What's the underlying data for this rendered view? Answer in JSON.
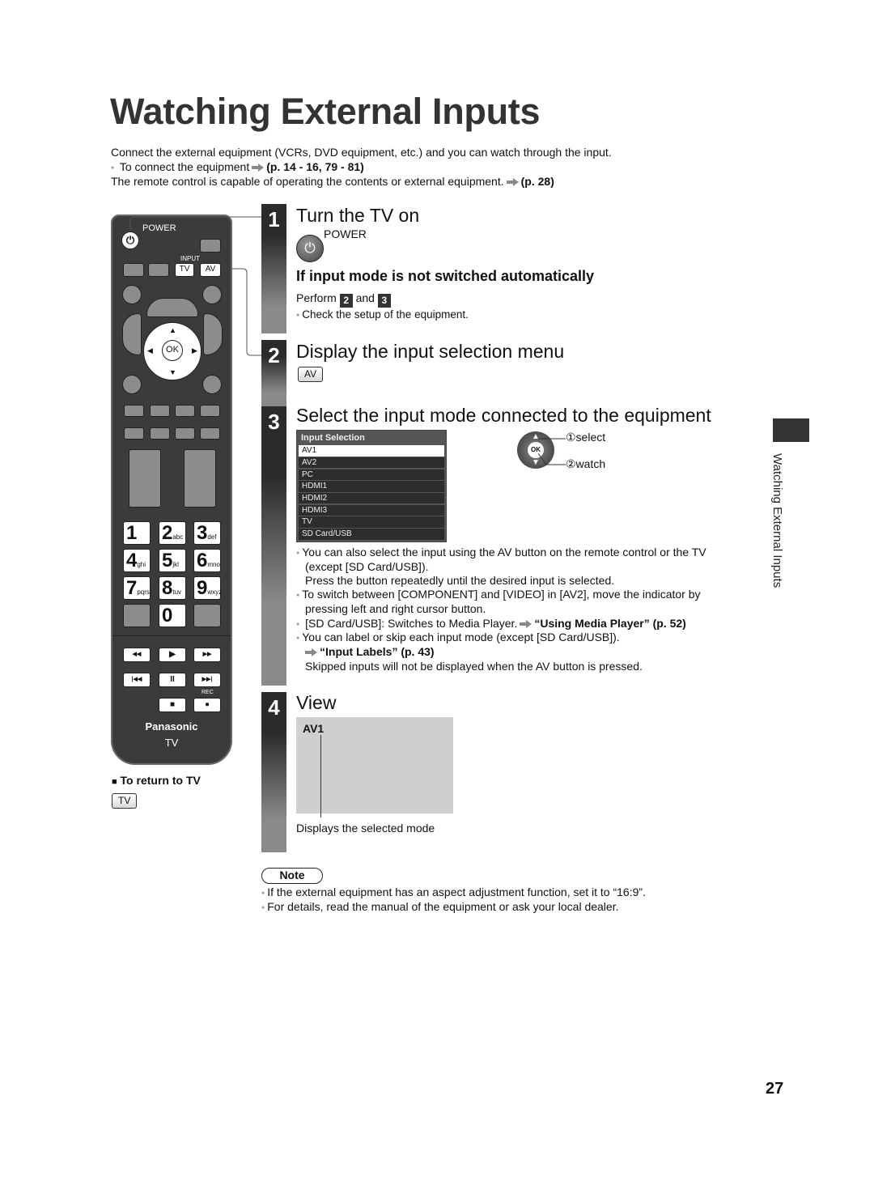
{
  "page": {
    "title": "Watching External Inputs",
    "intro_line1": "Connect the external equipment (VCRs, DVD equipment, etc.) and you can watch through the input.",
    "intro_bullet": "To connect the equipment",
    "intro_bullet_ref": "(p. 14 - 16, 79 - 81)",
    "intro_line3": "The remote control is capable of operating the contents or external equipment.",
    "intro_line3_ref": "(p. 28)",
    "page_number": "27",
    "side_label": "Watching External Inputs"
  },
  "remote": {
    "power_label": "POWER",
    "input_label": "INPUT",
    "tv_key": "TV",
    "av_key": "AV",
    "ok_label": "OK",
    "numpad": [
      {
        "digit": "1",
        "letters": ""
      },
      {
        "digit": "2",
        "letters": "abc"
      },
      {
        "digit": "3",
        "letters": "def"
      },
      {
        "digit": "4",
        "letters": "ghi"
      },
      {
        "digit": "5",
        "letters": "jkl"
      },
      {
        "digit": "6",
        "letters": "mno"
      },
      {
        "digit": "7",
        "letters": "pqrs"
      },
      {
        "digit": "8",
        "letters": "tuv"
      },
      {
        "digit": "9",
        "letters": "wxyz"
      },
      {
        "digit": "0",
        "letters": ""
      }
    ],
    "media": {
      "rewind": "◀◀",
      "play": "▶",
      "ffwd": "▶▶",
      "skip_back": "|◀◀",
      "pause": "II",
      "skip_fwd": "▶▶|",
      "stop": "■",
      "rec": "●",
      "rec_label": "REC"
    },
    "brand": "Panasonic",
    "model": "TV",
    "return_heading": "To return to TV",
    "return_key": "TV"
  },
  "steps": [
    {
      "number": "1",
      "heading": "Turn the TV on",
      "power_label": "POWER",
      "subheading": "If input mode is not switched automatically",
      "perform_prefix": "Perform",
      "perform_step_a": "2",
      "perform_and": "and",
      "perform_step_b": "3",
      "bullet": "Check the setup of the equipment."
    },
    {
      "number": "2",
      "heading": "Display the input selection menu",
      "key": "AV"
    },
    {
      "number": "3",
      "heading": "Select the input mode connected to the equipment",
      "menu": {
        "title": "Input Selection",
        "selected": "AV1",
        "items": [
          "AV1",
          "AV2",
          "PC",
          "HDMI1",
          "HDMI2",
          "HDMI3",
          "TV",
          "SD Card/USB"
        ]
      },
      "ok_label": "OK",
      "callout_select": "①select",
      "callout_watch": "②watch",
      "bullets": [
        {
          "text": "You can also select the input using the AV button on the remote control or the TV",
          "cont": [
            "(except [SD Card/USB]).",
            "Press the button repeatedly until the desired input is selected."
          ]
        },
        {
          "text": "To switch between [COMPONENT] and [VIDEO] in [AV2], move the indicator by",
          "cont": [
            "pressing left and right cursor button."
          ]
        },
        {
          "text": "[SD Card/USB]: Switches to Media Player.",
          "ref": "“Using Media Player” (p. 52)"
        },
        {
          "text": "You can label or skip each input mode (except [SD Card/USB]).",
          "ref": "“Input Labels” (p. 43)",
          "cont": [
            "Skipped inputs will not be displayed when the AV button is pressed."
          ]
        }
      ]
    },
    {
      "number": "4",
      "heading": "View",
      "screen_label": "AV1",
      "caption": "Displays the selected mode"
    }
  ],
  "note": {
    "label": "Note",
    "items": [
      "If the external equipment has an aspect adjustment function, set it to “16:9”.",
      "For details, read the manual of the equipment or ask your local dealer."
    ]
  }
}
